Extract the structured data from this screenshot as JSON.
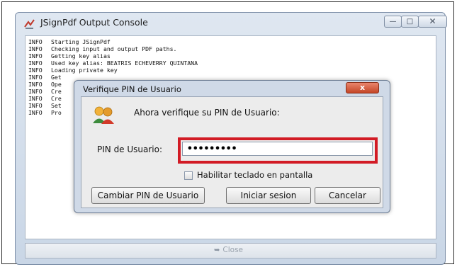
{
  "console": {
    "title": "JSignPdf Output Console",
    "min_label": "—",
    "max_label": "□",
    "close_label": "✕",
    "log": [
      {
        "level": "INFO",
        "text": "Starting JSignPdf"
      },
      {
        "level": "INFO",
        "text": "Checking input and output PDF paths."
      },
      {
        "level": "INFO",
        "text": "Getting key alias"
      },
      {
        "level": "INFO",
        "text": "Used key alias: BEATRIS ECHEVERRY QUINTANA"
      },
      {
        "level": "INFO",
        "text": "Loading private key"
      },
      {
        "level": "INFO",
        "text": "Get"
      },
      {
        "level": "INFO",
        "text": "Ope"
      },
      {
        "level": "INFO",
        "text": "Cre"
      },
      {
        "level": "INFO",
        "text": "Cre"
      },
      {
        "level": "INFO",
        "text": "Set"
      },
      {
        "level": "INFO",
        "text": "Pro"
      }
    ],
    "footer_close_label": "Close"
  },
  "dialog": {
    "title": "Verifique PIN de Usuario",
    "close_label": "x",
    "prompt": "Ahora verifique su PIN de Usuario:",
    "pin_label": "PIN de Usuario:",
    "pin_value": "•••••••••",
    "checkbox_label": "Habilitar teclado en pantalla",
    "checkbox_checked": false,
    "buttons": {
      "change_pin": "Cambiar PIN de Usuario",
      "login": "Iniciar sesion",
      "cancel": "Cancelar"
    }
  },
  "colors": {
    "highlight": "#d21b25",
    "dialog_close": "#c44626"
  },
  "icons": {
    "app": "jsignpdf-app-icon",
    "users": "users-icon",
    "close_footer": "close-arrow-icon"
  }
}
